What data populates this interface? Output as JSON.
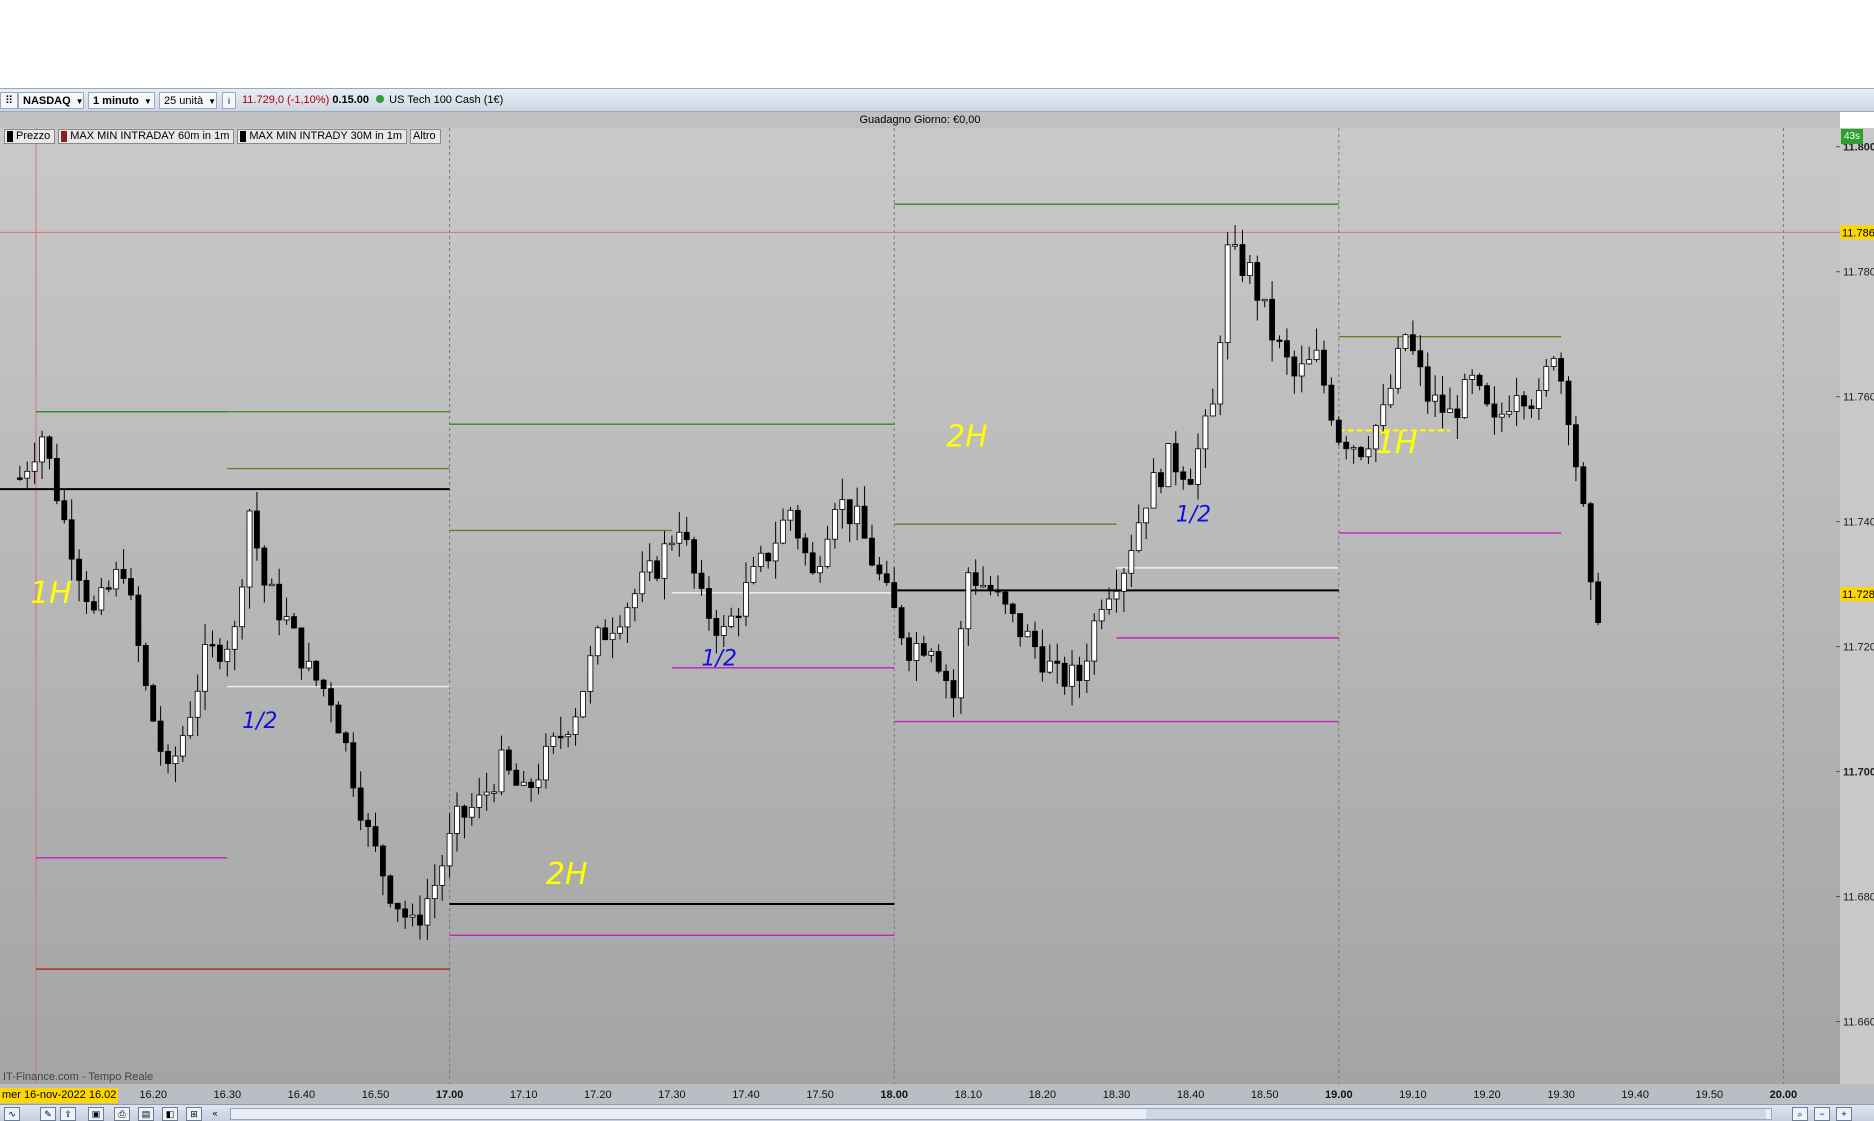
{
  "toolbar": {
    "instrument": "NASDAQ",
    "timeframe": "1 minuto",
    "units": "25 unità",
    "quote_price": "11.729,0 (-1,10%)",
    "quote_time": "0.15.00",
    "market_name": "US Tech 100 Cash (1€)",
    "info_icon": "info-icon",
    "status_dot_color": "#2e9e2e"
  },
  "gain_bar": {
    "text": "Guadagno Giorno:  €0,00"
  },
  "legend": [
    {
      "label": "Prezzo",
      "color": "#000000"
    },
    {
      "label": "MAX MIN INTRADAY 60m in 1m",
      "color": "#8a1f1f"
    },
    {
      "label": "MAX MIN INTRADY 30M in 1m",
      "color": "#000000"
    },
    {
      "label": "Altro",
      "color": ""
    }
  ],
  "timer_badge": "43s",
  "source_label": "IT-Finance.com - Tempo Reale",
  "date_label": "mer 16-nov-2022 16.02",
  "colors": {
    "up": "#ffffff",
    "down": "#000000",
    "highlight": "#ffd700",
    "ref_line": "#e07070",
    "annotation_yellow": "#ffff00",
    "annotation_blue": "#1010e0"
  },
  "chart_data": {
    "type": "candlestick",
    "title": "",
    "xlabel": "",
    "ylabel": "",
    "grid": true,
    "ylim": [
      11650,
      11803
    ],
    "x_ticks": [
      "16.20",
      "16.30",
      "16.40",
      "16.50",
      "17.00",
      "17.10",
      "17.20",
      "17.30",
      "17.40",
      "17.50",
      "18.00",
      "18.10",
      "18.20",
      "18.30",
      "18.40",
      "18.50",
      "19.00",
      "19.10",
      "19.20",
      "19.30",
      "19.40",
      "19.50",
      "20.00"
    ],
    "x_ticks_bold": [
      "17.00",
      "18.00",
      "19.00",
      "20.00"
    ],
    "y_ticks": [
      "11.800",
      "11.780",
      "11.760",
      "11.740",
      "11.720",
      "11.700",
      "11.680",
      "11.660"
    ],
    "y_tick_values": [
      11800,
      11780,
      11760,
      11740,
      11720,
      11700,
      11680,
      11660
    ],
    "price_tags": [
      {
        "label": "11.786",
        "value": 11786.3
      },
      {
        "label": "11.728",
        "value": 11728.4
      }
    ],
    "reference_line": 11786.3,
    "time_start": "16.02",
    "time_end": "20.00",
    "close_path": [
      [
        "16.02",
        11747
      ],
      [
        "16.05",
        11754
      ],
      [
        "16.08",
        11740
      ],
      [
        "16.12",
        11725
      ],
      [
        "16.16",
        11733
      ],
      [
        "16.19",
        11713
      ],
      [
        "16.22",
        11699
      ],
      [
        "16.24",
        11706
      ],
      [
        "16.27",
        11718
      ],
      [
        "16.31",
        11722
      ],
      [
        "16.33",
        11742
      ],
      [
        "16.35",
        11730
      ],
      [
        "16.38",
        11724
      ],
      [
        "16.41",
        11716
      ],
      [
        "16.44",
        11712
      ],
      [
        "16.46",
        11704
      ],
      [
        "16.49",
        11690
      ],
      [
        "16.52",
        11681
      ],
      [
        "16.55",
        11675
      ],
      [
        "16.58",
        11682
      ],
      [
        "17.01",
        11692
      ],
      [
        "17.04",
        11695
      ],
      [
        "17.07",
        11701
      ],
      [
        "17.10",
        11696
      ],
      [
        "17.14",
        11704
      ],
      [
        "17.17",
        11710
      ],
      [
        "17.20",
        11721
      ],
      [
        "17.24",
        11727
      ],
      [
        "17.28",
        11733
      ],
      [
        "17.31",
        11740
      ],
      [
        "17.34",
        11727
      ],
      [
        "17.37",
        11722
      ],
      [
        "17.40",
        11729
      ],
      [
        "17.43",
        11735
      ],
      [
        "17.46",
        11742
      ],
      [
        "17.49",
        11731
      ],
      [
        "17.52",
        11744
      ],
      [
        "17.55",
        11740
      ],
      [
        "17.59",
        11728
      ],
      [
        "18.02",
        11720
      ],
      [
        "18.05",
        11721
      ],
      [
        "18.08",
        11712
      ],
      [
        "18.10",
        11732
      ],
      [
        "18.13",
        11729
      ],
      [
        "18.16",
        11724
      ],
      [
        "18.19",
        11720
      ],
      [
        "18.22",
        11715
      ],
      [
        "18.25",
        11715
      ],
      [
        "18.28",
        11728
      ],
      [
        "18.31",
        11733
      ],
      [
        "18.34",
        11744
      ],
      [
        "18.37",
        11750
      ],
      [
        "18.40",
        11748
      ],
      [
        "18.43",
        11758
      ],
      [
        "18.45",
        11783
      ],
      [
        "18.48",
        11780
      ],
      [
        "18.51",
        11770
      ],
      [
        "18.54",
        11763
      ],
      [
        "18.57",
        11766
      ],
      [
        "19.00",
        11754
      ],
      [
        "19.03",
        11752
      ],
      [
        "19.06",
        11757
      ],
      [
        "19.09",
        11770
      ],
      [
        "19.12",
        11760
      ],
      [
        "19.15",
        11757
      ],
      [
        "19.18",
        11762
      ],
      [
        "19.21",
        11755
      ],
      [
        "19.24",
        11762
      ],
      [
        "19.27",
        11759
      ],
      [
        "19.29",
        11768
      ],
      [
        "19.31",
        11758
      ],
      [
        "19.33",
        11741
      ],
      [
        "19.34",
        11728
      ],
      [
        "19.35",
        11726
      ]
    ],
    "session_levels": [
      {
        "from": "16.05",
        "to": "16.30",
        "value": 11757.6,
        "color": "#2a8a2a"
      },
      {
        "from": "16.30",
        "to": "17.00",
        "value": 11757.6,
        "color": "#5a8a2a"
      },
      {
        "from": "16.05",
        "to": "16.30",
        "value": 11686.2,
        "color": "#c020c0"
      },
      {
        "from": "16.05",
        "to": "17.00",
        "value": 11668.4,
        "color": "#b02020"
      },
      {
        "from": "16.30",
        "to": "17.00",
        "value": 11748.5,
        "color": "#6a7a2a"
      },
      {
        "from": "16.30",
        "to": "17.00",
        "value": 11713.6,
        "color": "#f0f0f0"
      },
      {
        "from": "16.02",
        "to": "17.00",
        "value": 11745.2,
        "color": "#000000"
      },
      {
        "from": "17.00",
        "to": "18.00",
        "value": 11755.6,
        "color": "#2a8a2a"
      },
      {
        "from": "17.00",
        "to": "17.30",
        "value": 11738.6,
        "color": "#6a7a2a"
      },
      {
        "from": "17.00",
        "to": "18.00",
        "value": 11678.8,
        "color": "#000000"
      },
      {
        "from": "17.00",
        "to": "18.00",
        "value": 11673.8,
        "color": "#c020c0"
      },
      {
        "from": "17.30",
        "to": "18.00",
        "value": 11728.6,
        "color": "#f0f0f0"
      },
      {
        "from": "17.30",
        "to": "18.00",
        "value": 11716.6,
        "color": "#c020c0"
      },
      {
        "from": "18.00",
        "to": "19.00",
        "value": 11790.8,
        "color": "#2a8a2a"
      },
      {
        "from": "18.00",
        "to": "18.30",
        "value": 11739.6,
        "color": "#6a7a2a"
      },
      {
        "from": "18.00",
        "to": "19.00",
        "value": 11729.0,
        "color": "#000000"
      },
      {
        "from": "18.00",
        "to": "19.00",
        "value": 11708.0,
        "color": "#c020c0"
      },
      {
        "from": "18.30",
        "to": "19.00",
        "value": 11732.6,
        "color": "#f0f0f0"
      },
      {
        "from": "18.30",
        "to": "19.00",
        "value": 11721.4,
        "color": "#c020c0"
      },
      {
        "from": "19.00",
        "to": "19.30",
        "value": 11769.6,
        "color": "#6a7a2a"
      },
      {
        "from": "19.00",
        "to": "19.30",
        "value": 11738.2,
        "color": "#c020c0"
      },
      {
        "from": "19.00",
        "to": "19.15",
        "value": 11754.6,
        "color": "#ffff00"
      }
    ],
    "annotations": [
      {
        "text": "1H",
        "time": "16.02",
        "value": 11727,
        "color": "#ffff00"
      },
      {
        "text": "1/2",
        "time": "16.32",
        "value": 11707,
        "color": "#1010e0"
      },
      {
        "text": "2H",
        "time": "17.13",
        "value": 11682,
        "color": "#ffff00"
      },
      {
        "text": "1/2",
        "time": "17.34",
        "value": 11717,
        "color": "#1010e0"
      },
      {
        "text": "2H",
        "time": "18.07",
        "value": 11752,
        "color": "#ffff00"
      },
      {
        "text": "1/2",
        "time": "18.38",
        "value": 11740,
        "color": "#1010e0"
      },
      {
        "text": "1H",
        "time": "19.05",
        "value": 11751,
        "color": "#ffff00"
      }
    ]
  }
}
